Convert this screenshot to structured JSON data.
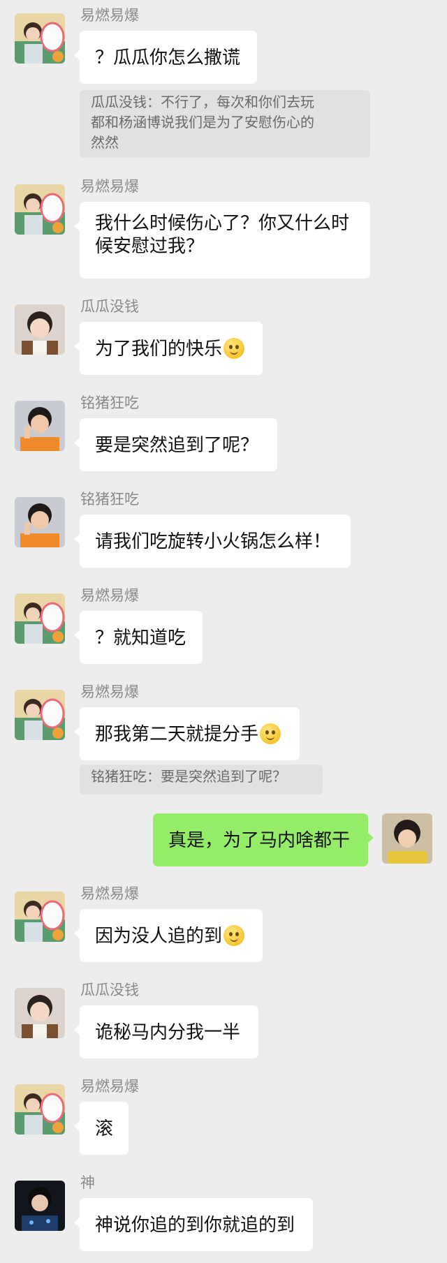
{
  "messages": [
    {
      "sender": "易燃易爆",
      "text": "？瓜瓜你怎么撒谎"
    },
    {
      "quote": "瓜瓜没钱：不行了，每次和你们去玩都和杨涵博说我们是为了安慰伤心的然然"
    },
    {
      "sender": "易燃易爆",
      "line1": "我什么时候伤心了？你又什么时",
      "line2": "候安慰过我？"
    },
    {
      "sender": "瓜瓜没钱",
      "text": "为了我们的快乐",
      "emoji": "pleading-face-emoji"
    },
    {
      "sender": "铭猪狂吃",
      "text": "要是突然追到了呢？"
    },
    {
      "sender": "铭猪狂吃",
      "text": "请我们吃旋转小火锅怎么样！"
    },
    {
      "sender": "易燃易爆",
      "text": "？就知道吃"
    },
    {
      "sender": "易燃易爆",
      "text": "那我第二天就提分手",
      "emoji": "thinking-face-emoji"
    },
    {
      "quote": "铭猪狂吃：要是突然追到了呢？"
    },
    {
      "mine": true,
      "text": "真是，为了马内啥都干"
    },
    {
      "sender": "易燃易爆",
      "text": "因为没人追的到",
      "emoji": "sweat-face-emoji"
    },
    {
      "sender": "瓜瓜没钱",
      "text": "诡秘马内分我一半"
    },
    {
      "sender": "易燃易爆",
      "text": "滚"
    },
    {
      "sender": "神",
      "text": "神说你追的到你就追的到"
    }
  ],
  "quote_lines": {
    "q1_line1": "瓜瓜没钱：不行了，每次和你们去玩",
    "q1_line2": "都和杨涵博说我们是为了安慰伤心的",
    "q1_line3": "然然"
  },
  "colors": {
    "background": "#ededed",
    "bubble_incoming": "#ffffff",
    "bubble_outgoing": "#95ec69",
    "quote_background": "#e1e1e1",
    "sender_name": "#8a8a8a"
  }
}
